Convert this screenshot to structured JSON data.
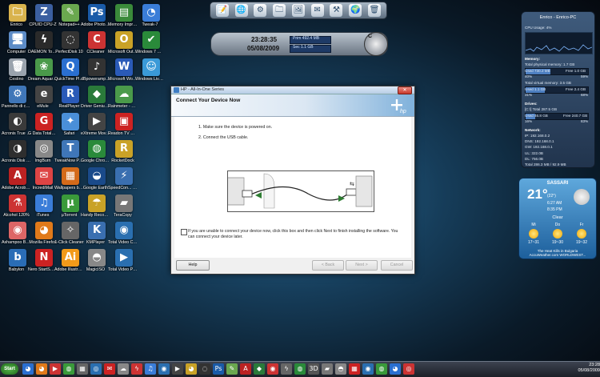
{
  "desktop": {
    "icons": [
      {
        "label": "Enrico",
        "glyph": "🗀",
        "color": "#d9b34d"
      },
      {
        "label": "Computer",
        "glyph": "🖥",
        "color": "#5d8cc7"
      },
      {
        "label": "Cestino",
        "glyph": "🗑",
        "color": "#9aa3ad"
      },
      {
        "label": "Pannello di controllo",
        "glyph": "⚙",
        "color": "#3f76b8"
      },
      {
        "label": "Acronis True Image Ho...",
        "glyph": "◐",
        "color": "#3a3a3a"
      },
      {
        "label": "Acronis Disk Director S...",
        "glyph": "◑",
        "color": "#2e2e2e"
      },
      {
        "label": "Adobe Acrobat...",
        "glyph": "A",
        "color": "#b22"
      },
      {
        "label": "Alcohol 120%",
        "glyph": "⚗",
        "color": "#c33"
      },
      {
        "label": "Ashampoo Burning ...",
        "glyph": "◉",
        "color": "#d66"
      },
      {
        "label": "Babylon",
        "glyph": "b",
        "color": "#2a6db6"
      },
      {
        "label": "CPUID CPU-Z",
        "glyph": "Z",
        "color": "#3b5fa0"
      },
      {
        "label": "DAEMON Tools Pro",
        "glyph": "ϟ",
        "color": "#2a2a2a"
      },
      {
        "label": "Dream Aquarium",
        "glyph": "❀",
        "color": "#4a9a4a"
      },
      {
        "label": "eMule",
        "glyph": "e",
        "color": "#444"
      },
      {
        "label": "G Data TotalCare",
        "glyph": "G",
        "color": "#c22"
      },
      {
        "label": "ImgBurn",
        "glyph": "◎",
        "color": "#888"
      },
      {
        "label": "IncrediMail",
        "glyph": "✉",
        "color": "#d44"
      },
      {
        "label": "iTunes",
        "glyph": "♫",
        "color": "#3a7dd8"
      },
      {
        "label": "Mozilla Firefox",
        "glyph": "◕",
        "color": "#e07a1a"
      },
      {
        "label": "Nero StartSmart",
        "glyph": "N",
        "color": "#c22"
      },
      {
        "label": "Notepad++",
        "glyph": "✎",
        "color": "#6aa84f"
      },
      {
        "label": "PerfectDisk 10",
        "glyph": "◌",
        "color": "#333"
      },
      {
        "label": "QuickTime Player",
        "glyph": "Q",
        "color": "#2a6fd0"
      },
      {
        "label": "RealPlayer",
        "glyph": "R",
        "color": "#2a5ab8"
      },
      {
        "label": "Safari",
        "glyph": "✦",
        "color": "#4a8fd8"
      },
      {
        "label": "TweakNow PowerPa...",
        "glyph": "T",
        "color": "#3f76b8"
      },
      {
        "label": "Wallpapers by Incred...",
        "glyph": "▦",
        "color": "#d46a1a"
      },
      {
        "label": "µTorrent",
        "glyph": "µ",
        "color": "#3a9a3a"
      },
      {
        "label": "1-Click Cleaner",
        "glyph": "✧",
        "color": "#666"
      },
      {
        "label": "Adobe Illustrator...",
        "glyph": "Ai",
        "color": "#f29a1a"
      },
      {
        "label": "Adobe Photosho...",
        "glyph": "Ps",
        "color": "#1a5ba8"
      },
      {
        "label": "CCleaner",
        "glyph": "C",
        "color": "#c33"
      },
      {
        "label": "dBpoweramp Music Con...",
        "glyph": "♪",
        "color": "#333"
      },
      {
        "label": "Driver Genius Pr...",
        "glyph": "◆",
        "color": "#2a7a3a"
      },
      {
        "label": "eXtreme Movie ...",
        "glyph": "▶",
        "color": "#444"
      },
      {
        "label": "Google Chrome",
        "glyph": "◍",
        "color": "#2a8a3a"
      },
      {
        "label": "Google Earth",
        "glyph": "◒",
        "color": "#1a4a8a"
      },
      {
        "label": "Handy Recovery",
        "glyph": "☂",
        "color": "#c9a227"
      },
      {
        "label": "KMPlayer",
        "glyph": "K",
        "color": "#3a6fb0"
      },
      {
        "label": "MagicISO",
        "glyph": "◓",
        "color": "#888"
      },
      {
        "label": "Memory Improve P...",
        "glyph": "▤",
        "color": "#3a8a3a"
      },
      {
        "label": "Microsoft Outlook...",
        "glyph": "O",
        "color": "#c9a227"
      },
      {
        "label": "Microsoft Word 2010",
        "glyph": "W",
        "color": "#2a5ab8"
      },
      {
        "label": "Rainmeter - collegame...",
        "glyph": "☁",
        "color": "#4a9a4a"
      },
      {
        "label": "Readon TV Movie Rad...",
        "glyph": "▣",
        "color": "#c22"
      },
      {
        "label": "RocketDock",
        "glyph": "R",
        "color": "#c9a227"
      },
      {
        "label": "SpeedCon... Internet A...",
        "glyph": "⚡",
        "color": "#3a6fb0"
      },
      {
        "label": "TeraCopy",
        "glyph": "▰",
        "color": "#777"
      },
      {
        "label": "Total Video Converter",
        "glyph": "◉",
        "color": "#2a6fb0"
      },
      {
        "label": "Total Video Player",
        "glyph": "▶",
        "color": "#2a6fb0"
      },
      {
        "label": "Tweak-7",
        "glyph": "◔",
        "color": "#3a7dd8"
      },
      {
        "label": "Windows 7 Manager",
        "glyph": "✔",
        "color": "#2a8a3a"
      },
      {
        "label": "Windows Live Mess...",
        "glyph": "☺",
        "color": "#3a9ad8"
      }
    ]
  },
  "dock": {
    "items": [
      "📝",
      "🌐",
      "⚙",
      "🗀",
      "🖼",
      "✉",
      "⚒",
      "🌍",
      "🗑"
    ]
  },
  "clock": {
    "time": "23:28:35",
    "date": "05/08/2009",
    "ram": "Prim 492.4 MB",
    "hd": "Sec 1.1 GB",
    "cpu_letter": "C"
  },
  "sysmon": {
    "title": "Enrico - Enrico-PC",
    "cpu": "CPU Usage: 4%",
    "memory_header": "Memory:",
    "phys": "Total physical memory: 1.7 GB",
    "used1": "Used 730.2 MB",
    "free1": "Free 1.0 GB",
    "pct1a": "40%",
    "pct1b": "59%",
    "virt": "Total virtual memory: 3.5 GB",
    "used2": "Used 1.1 GB",
    "free2": "Free 2.4 GB",
    "pct2a": "31%",
    "pct2b": "68%",
    "drives_header": "Drives:",
    "drive": "[C:\\] Total 287.5 GB",
    "used3": "Used 46.8 GB",
    "free3": "Free 240.7 GB",
    "pct3a": "16%",
    "pct3b": "83%",
    "network_header": "Network:",
    "ip": "IP:    192.168.0.2",
    "dns": "DNS:  192.168.0.1",
    "gw": "GW:   192.168.0.1",
    "ul": "UL:  322.0B",
    "dl": "DL:  756.0B",
    "total": "Total    286.3 MB / 92.9 MB",
    "bars": {
      "used1": 0.4,
      "used2": 0.31,
      "used3": 0.16
    }
  },
  "weather": {
    "city": "SASSARI",
    "temp": "21°",
    "temp_sub": "(22°)",
    "sunrise": "6:27 AM",
    "sunset": "8:35 PM",
    "condition": "Clear",
    "days": [
      {
        "name": "Mi",
        "range": "17~31"
      },
      {
        "name": "Do",
        "range": "19~30"
      },
      {
        "name": "Fr",
        "range": "19~32"
      }
    ],
    "footer1": "The Heat Kills in Bulgaria",
    "footer2": "AccuWeather.com WORLDWEST..."
  },
  "dialog": {
    "title": "HP - All-In-One Series",
    "close": "✕",
    "header": "Connect Your Device Now",
    "step1": "1. Make sure the device is powered on.",
    "step2": "2. Connect the USB cable.",
    "checkbox_text": "If you are unable to connect your device now, click this box and then click Next to finish installing the software. You can connect your device later.",
    "help": "Help",
    "back": "< Back",
    "next": "Next >",
    "cancel": "Cancel"
  },
  "taskbar": {
    "start": "Start",
    "icons": [
      "◕",
      "◕",
      "▶",
      "◍",
      "▦",
      "◎",
      "✉",
      "☁",
      "ϟ",
      "♫",
      "◉",
      "▶",
      "◕",
      "◌",
      "Ps",
      "✎",
      "A",
      "◆",
      "◉",
      "ϟ",
      "◍",
      "3D",
      "▰",
      "◓",
      "▦",
      "◉",
      "◍",
      "◕",
      "◎"
    ],
    "icon_colors": [
      "#2a6fd0",
      "#e07a1a",
      "#c33",
      "#3a9a3a",
      "#666",
      "#2a6fb0",
      "#c22",
      "#888",
      "#c33",
      "#3a7dd8",
      "#2a6fb0",
      "#444",
      "#c9a227",
      "#333",
      "#1a5ba8",
      "#6aa84f",
      "#b22",
      "#2a7a3a",
      "#c33",
      "#666",
      "#2a8a3a",
      "#555",
      "#777",
      "#888",
      "#c22",
      "#2a6fb0",
      "#3a9a3a",
      "#2a6fd0",
      "#c33"
    ],
    "time": "23:28",
    "date": "05/08/2009"
  }
}
